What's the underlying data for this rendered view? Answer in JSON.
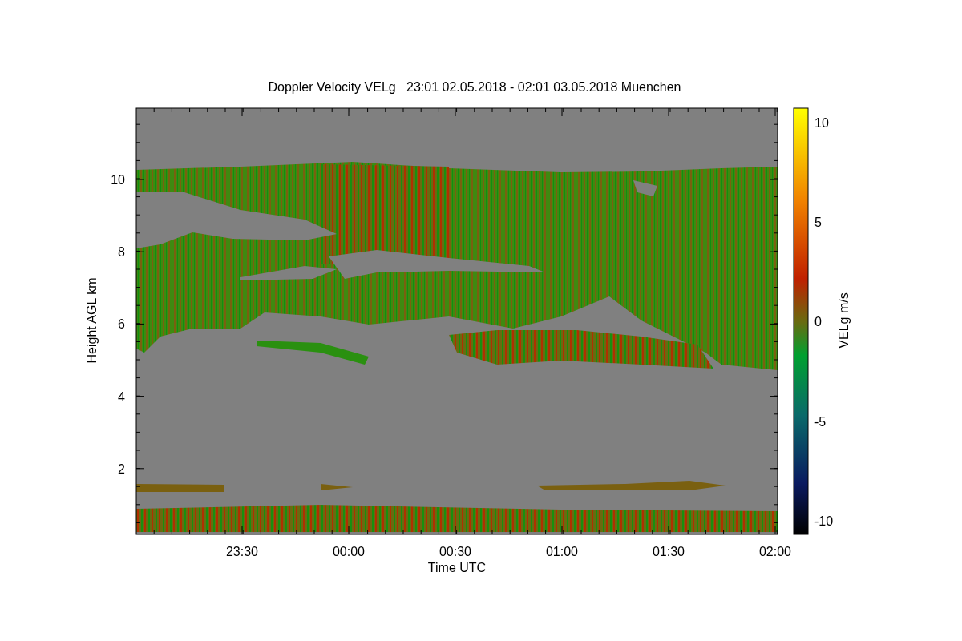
{
  "title": "Doppler Velocity VELg   23:01 02.05.2018 - 02:01 03.05.2018 Muenchen",
  "y_axis": {
    "label": "Height AGL km",
    "ticks": [
      "10",
      "8",
      "6",
      "4",
      "2"
    ]
  },
  "x_axis": {
    "label": "Time UTC",
    "ticks": [
      "23:30",
      "00:00",
      "00:30",
      "01:00",
      "01:30",
      "02:00"
    ]
  },
  "colorbar": {
    "label": "VELg m/s",
    "ticks": [
      "10",
      "5",
      "0",
      "-5",
      "-10"
    ]
  }
}
